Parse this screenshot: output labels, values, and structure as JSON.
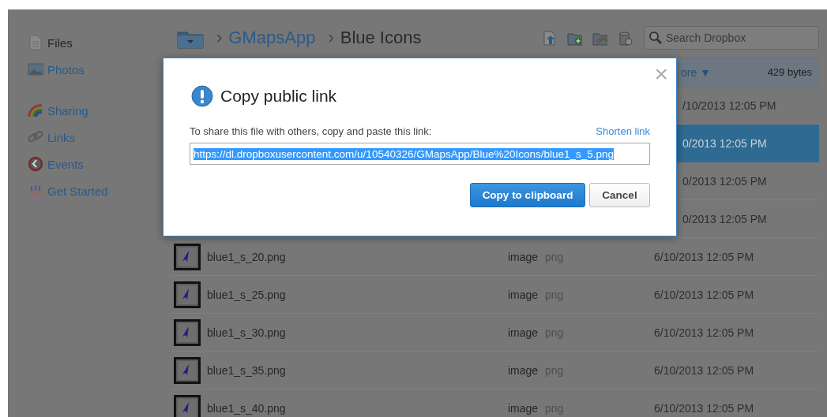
{
  "sidebar": {
    "groups": [
      {
        "items": [
          {
            "label": "Files",
            "selected": true
          },
          {
            "label": "Photos",
            "selected": false
          }
        ]
      },
      {
        "items": [
          {
            "label": "Sharing",
            "selected": false
          },
          {
            "label": "Links",
            "selected": false
          },
          {
            "label": "Events",
            "selected": false
          },
          {
            "label": "Get Started",
            "selected": false
          }
        ]
      }
    ]
  },
  "breadcrumb": [
    {
      "separator": "›",
      "label": "GMapsApp",
      "current": false
    },
    {
      "separator": "›",
      "label": "Blue Icons",
      "current": true
    }
  ],
  "search": {
    "placeholder": "Search Dropbox"
  },
  "file_list": {
    "header": {
      "column_4": "ore",
      "sort_arrow": "▼",
      "size": "429 bytes"
    },
    "rows": [
      {
        "modified": "/10/2013 12:05 PM",
        "selected": false
      },
      {
        "modified": "0/2013 12:05 PM",
        "selected": true
      },
      {
        "modified": "0/2013 12:05 PM",
        "selected": false
      },
      {
        "modified": "0/2013 12:05 PM",
        "selected": false
      },
      {
        "name": "blue1_s_20.png",
        "type": "image",
        "extension": "png",
        "modified": "6/10/2013 12:05 PM",
        "selected": false
      },
      {
        "name": "blue1_s_25.png",
        "type": "image",
        "extension": "png",
        "modified": "6/10/2013 12:05 PM",
        "selected": false
      },
      {
        "name": "blue1_s_30.png",
        "type": "image",
        "extension": "png",
        "modified": "6/10/2013 12:05 PM",
        "selected": false
      },
      {
        "name": "blue1_s_35.png",
        "type": "image",
        "extension": "png",
        "modified": "6/10/2013 12:05 PM",
        "selected": false
      },
      {
        "name": "blue1_s_40.png",
        "type": "image",
        "extension": "png",
        "modified": "6/10/2013 12:05 PM",
        "selected": false
      }
    ]
  },
  "dialog": {
    "close": "×",
    "title": "Copy public link",
    "message": "To share this file with others, copy and paste this link:",
    "shorten_link": "Shorten link",
    "link": {
      "value": "https://dl.dropboxusercontent.com/u/10540326/GMapsApp/Blue%20Icons/blue1_s_5.png",
      "text_selected": true
    },
    "buttons": [
      {
        "label": "Copy to clipboard",
        "kind": "primary"
      },
      {
        "label": "Cancel",
        "kind": "secondary"
      }
    ]
  }
}
